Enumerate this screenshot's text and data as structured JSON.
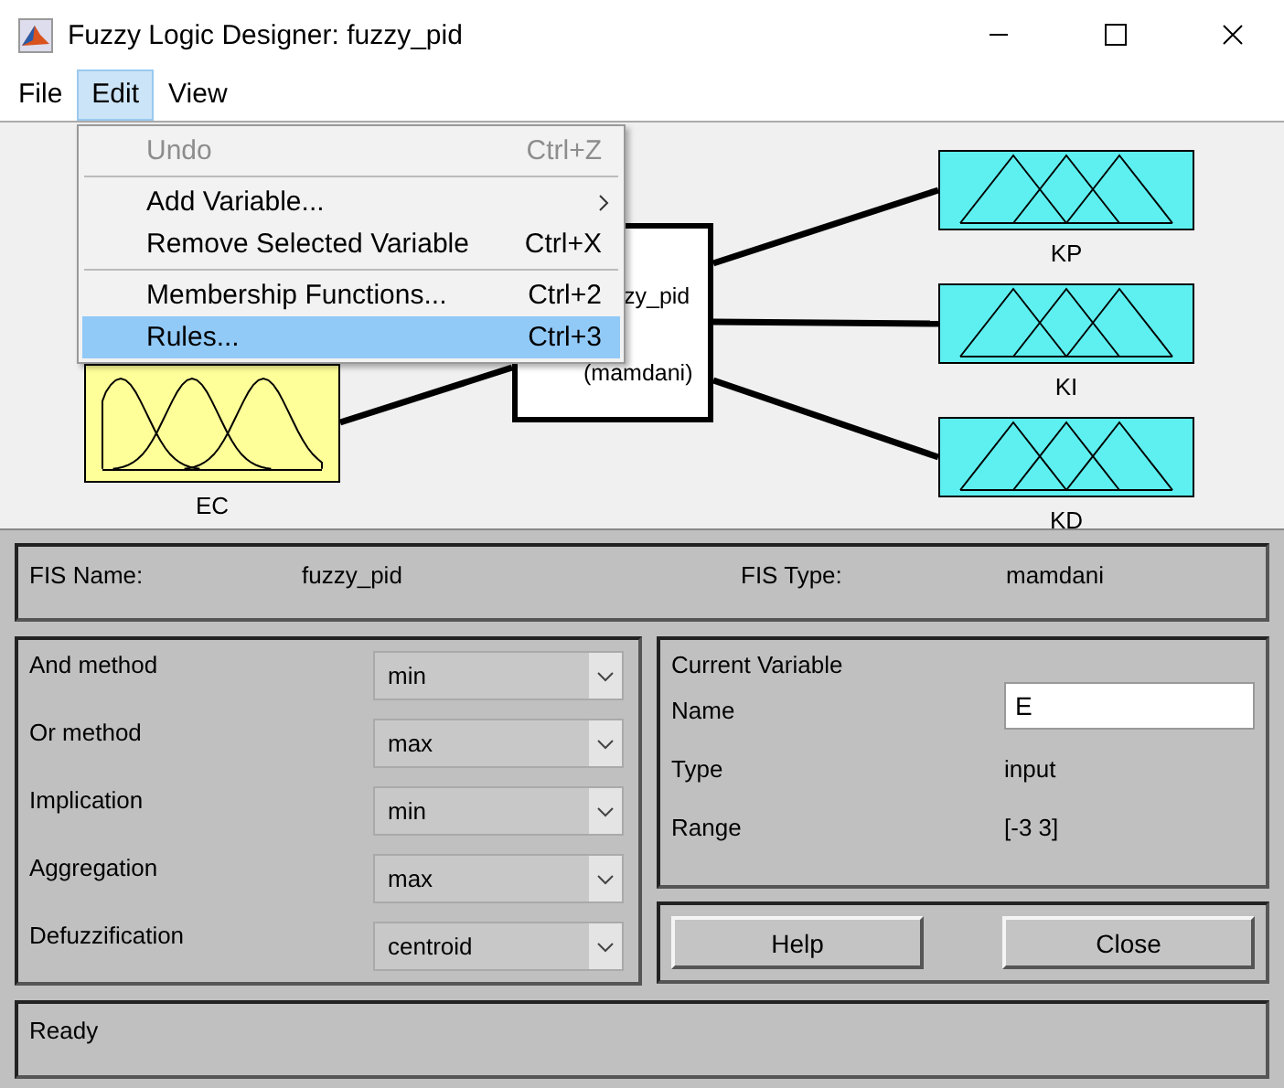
{
  "window": {
    "title": "Fuzzy Logic Designer: fuzzy_pid"
  },
  "menu_bar": [
    {
      "label": "File",
      "selected": false
    },
    {
      "label": "Edit",
      "selected": true
    },
    {
      "label": "View",
      "selected": false
    }
  ],
  "edit_menu": [
    {
      "kind": "item",
      "label": "Undo",
      "shortcut": "Ctrl+Z",
      "disabled": true,
      "selected": false
    },
    {
      "kind": "separator"
    },
    {
      "kind": "submenu",
      "label": "Add Variable...",
      "disabled": false,
      "selected": false
    },
    {
      "kind": "item",
      "label": "Remove Selected Variable",
      "shortcut": "Ctrl+X",
      "disabled": false,
      "selected": false
    },
    {
      "kind": "separator"
    },
    {
      "kind": "item",
      "label": "Membership Functions...",
      "shortcut": "Ctrl+2",
      "disabled": false,
      "selected": false
    },
    {
      "kind": "item",
      "label": "Rules...",
      "shortcut": "Ctrl+3",
      "disabled": false,
      "selected": true
    }
  ],
  "diagram": {
    "inputs": [
      {
        "label": "EC"
      }
    ],
    "system": [
      "zy_pid",
      "(mamdani)"
    ],
    "outputs": [
      {
        "label": "KP"
      },
      {
        "label": "KI"
      },
      {
        "label": "KD"
      }
    ]
  },
  "fis": {
    "name_label": "FIS Name:",
    "name": "fuzzy_pid",
    "type_label": "FIS Type:",
    "type": "mamdani"
  },
  "methods": [
    {
      "label": "And method",
      "value": "min"
    },
    {
      "label": "Or method",
      "value": "max"
    },
    {
      "label": "Implication",
      "value": "min"
    },
    {
      "label": "Aggregation",
      "value": "max"
    },
    {
      "label": "Defuzzification",
      "value": "centroid"
    }
  ],
  "current_variable": {
    "title": "Current Variable",
    "fields": [
      {
        "kind": "field",
        "label": "Name",
        "value": "E"
      },
      {
        "kind": "text",
        "label": "Type",
        "value": "input"
      },
      {
        "kind": "text",
        "label": "Range",
        "value": "[-3 3]"
      }
    ]
  },
  "buttons": [
    "Help",
    "Close"
  ],
  "status": "Ready"
}
